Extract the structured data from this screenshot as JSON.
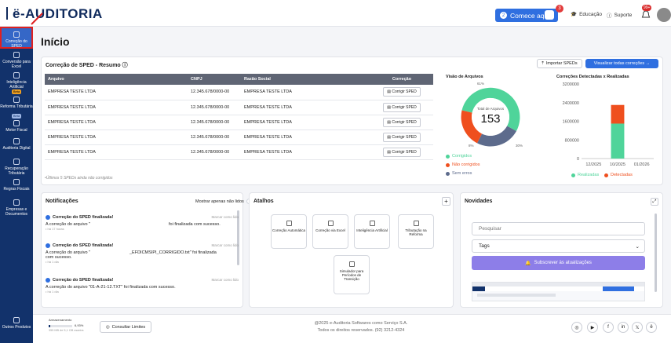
{
  "app": {
    "logo": "ë-AUDITORIA"
  },
  "topbar": {
    "start_label": "Comece aqui",
    "start_number": "2",
    "start_badge": "3",
    "education_label": "Educação",
    "support_label": "Suporte",
    "notif_badge": "99+"
  },
  "sidebar": {
    "items": [
      {
        "label": "Correção do SPED"
      },
      {
        "label": "Conversão para Excel"
      },
      {
        "label": "Inteligência Artificial"
      },
      {
        "label": "Beta",
        "tag": true
      },
      {
        "label": "Reforma Tributária"
      },
      {
        "label": "Beta",
        "tag": true
      },
      {
        "label": "Motor Fiscal"
      },
      {
        "label": "Auditoria Digital"
      },
      {
        "label": "Recuperação Tributária"
      },
      {
        "label": "Regras Fiscais"
      },
      {
        "label": "Empresas e Documentos"
      },
      {
        "label": "Outros Produtos"
      }
    ]
  },
  "page": {
    "title": "Início"
  },
  "sped": {
    "title": "Correção de SPED - Resumo",
    "import_label": "Importar SPEDs",
    "view_all_label": "Visualizar todas correções",
    "columns": [
      "Arquivo",
      "CNPJ",
      "Razão Social",
      "Correção"
    ],
    "rows": [
      {
        "arquivo": "EMPRESA TESTE LTDA",
        "cnpj": "12.345.678/0000-00",
        "razao": "EMPRESA TESTE LTDA",
        "acao": "Corrigir SPED"
      },
      {
        "arquivo": "EMPRESA TESTE LTDA",
        "cnpj": "12.345.678/0000-00",
        "razao": "EMPRESA TESTE LTDA",
        "acao": "Corrigir SPED"
      },
      {
        "arquivo": "EMPRESA TESTE LTDA",
        "cnpj": "12.345.678/0000-00",
        "razao": "EMPRESA TESTE LTDA",
        "acao": "Corrigir SPED"
      },
      {
        "arquivo": "EMPRESA TESTE LTDA",
        "cnpj": "12.345.678/0000-00",
        "razao": "EMPRESA TESTE LTDA",
        "acao": "Corrigir SPED"
      },
      {
        "arquivo": "EMPRESA TESTE LTDA",
        "cnpj": "12.345.678/0000-00",
        "razao": "EMPRESA TESTE LTDA",
        "acao": "Corrigir SPED"
      }
    ],
    "note": "•Últimos 5 SPEDs ainda não corrigidos"
  },
  "donut": {
    "title": "Visão de Arquivos",
    "total_label": "Total de Arquivos",
    "total": "153",
    "pct_top": "61%",
    "pct_left": "8%",
    "pct_right": "30%",
    "legend": [
      "Corrigidos",
      "Não corrigidos",
      "Sem erros"
    ],
    "colors": {
      "green": "#4fd49a",
      "red": "#ef4f1e",
      "slate": "#5d6b8c"
    }
  },
  "chart_data": {
    "type": "bar",
    "title": "Correções Detectadas x Realizadas",
    "categories": [
      "12/2025",
      "10/2025",
      "01/2026"
    ],
    "series": [
      {
        "name": "Realizadas",
        "values": [
          0,
          1500000,
          0
        ]
      },
      {
        "name": "Detectadas",
        "values": [
          0,
          800000,
          0
        ]
      }
    ],
    "yticks": [
      "3200000",
      "2400000",
      "1600000",
      "800000",
      "0"
    ],
    "ylim": [
      0,
      3200000
    ],
    "stacked": true,
    "legend": "bottom"
  },
  "notifications": {
    "title": "Notificações",
    "toggle_label": "Mostrar apenas não lidos",
    "mark_read": "Marcar como lido",
    "items": [
      {
        "title": "Correção do SPED finalizada!",
        "body": "A correção do arquivo \"",
        "body2": "foi finalizada com sucesso.",
        "time": "• há 17 horas"
      },
      {
        "title": "Correção do SPED finalizada!",
        "body": "A correção do arquivo \"",
        "body2": "_EFDICMSIPI_CORRIGIDO.txt\" foi finalizada",
        "body3": "com sucesso.",
        "time": "• há 1 dia"
      },
      {
        "title": "Correção do SPED finalizada!",
        "body": "A correção do arquivo \"01-A-21-12.TXT\" foi finalizada com sucesso.",
        "time": "• há 1 dia"
      }
    ]
  },
  "shortcuts": {
    "title": "Atalhos",
    "items": [
      {
        "label": "Correção Automática"
      },
      {
        "label": "Correção via Excel"
      },
      {
        "label": "Inteligência Artificial"
      },
      {
        "label": "Tributação na Reforma"
      },
      {
        "label": "Simulador para Períodos de Transição"
      }
    ]
  },
  "news": {
    "title": "Novidades",
    "search_placeholder": "Pesquisar",
    "tags_label": "Tags",
    "subscribe_label": "Subscrever às atualizações"
  },
  "footer": {
    "storage_label": "Armazenamento",
    "storage_pct": "6,93%",
    "storage_used": "355 MB de 5,1 GB usados",
    "limits_label": "Consultar Limites",
    "copyright": "@2025 e-Auditoria Softwares como Serviço S.A.",
    "rights": "Todos os direitos reservados. (92) 3212-4324"
  }
}
